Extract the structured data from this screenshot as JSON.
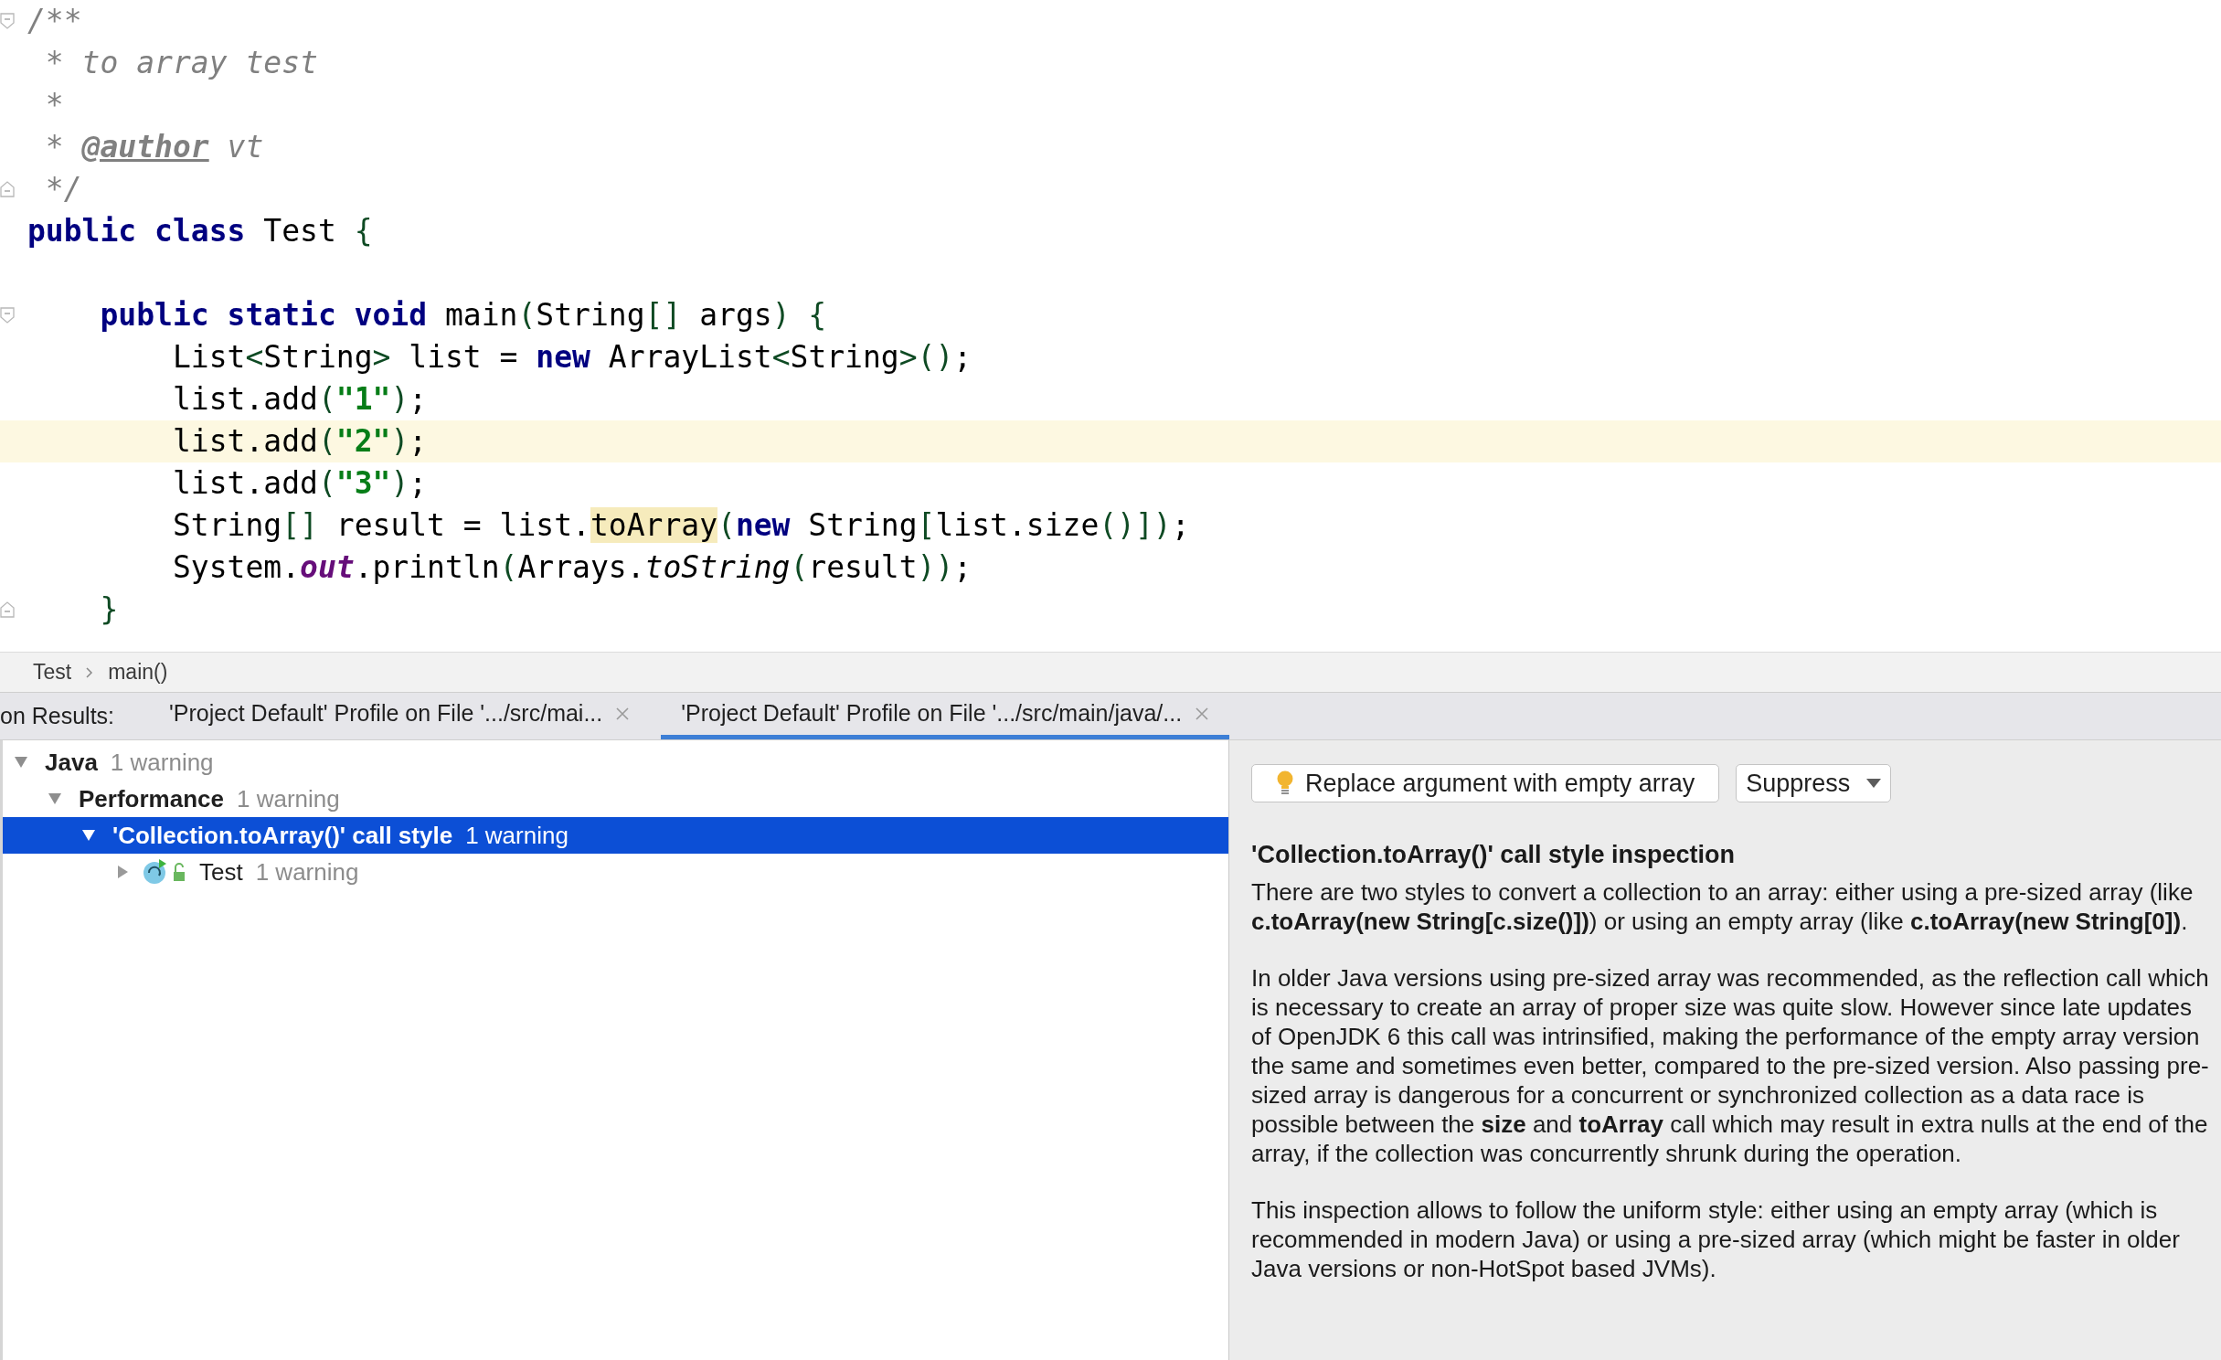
{
  "editor": {
    "lines": [
      {
        "fold_start": true,
        "current": false,
        "tokens": [
          {
            "text": "/**",
            "kind": "comment"
          }
        ]
      },
      {
        "current": false,
        "tokens": [
          {
            "text": " * to array test",
            "kind": "comment"
          }
        ]
      },
      {
        "current": false,
        "tokens": [
          {
            "text": " *",
            "kind": "comment"
          }
        ]
      },
      {
        "current": false,
        "tokens": [
          {
            "text": " * ",
            "kind": "comment"
          },
          {
            "text": "@author",
            "kind": "doc_tag"
          },
          {
            "text": " vt",
            "kind": "comment"
          }
        ]
      },
      {
        "fold_end": true,
        "current": false,
        "tokens": [
          {
            "text": " */",
            "kind": "comment"
          }
        ]
      },
      {
        "current": false,
        "tokens": [
          {
            "text": "public class",
            "kind": "keyword"
          },
          {
            "text": " Test ",
            "kind": "plain"
          },
          {
            "text": "{",
            "kind": "bracket"
          }
        ]
      },
      {
        "blank_before": true,
        "fold_start": true,
        "current": false,
        "tokens": [
          {
            "text": "    public static void",
            "kind": "keyword"
          },
          {
            "text": " main",
            "kind": "plain"
          },
          {
            "text": "(",
            "kind": "bracket"
          },
          {
            "text": "String",
            "kind": "plain"
          },
          {
            "text": "[]",
            "kind": "bracket"
          },
          {
            "text": " args",
            "kind": "plain"
          },
          {
            "text": ") {",
            "kind": "bracket"
          }
        ]
      },
      {
        "current": false,
        "tokens": [
          {
            "text": "        List",
            "kind": "plain"
          },
          {
            "text": "<",
            "kind": "bracket"
          },
          {
            "text": "String",
            "kind": "plain"
          },
          {
            "text": ">",
            "kind": "bracket"
          },
          {
            "text": " list = ",
            "kind": "plain"
          },
          {
            "text": "new",
            "kind": "keyword"
          },
          {
            "text": " ArrayList",
            "kind": "plain"
          },
          {
            "text": "<",
            "kind": "bracket"
          },
          {
            "text": "String",
            "kind": "plain"
          },
          {
            "text": ">()",
            "kind": "bracket"
          },
          {
            "text": ";",
            "kind": "plain"
          }
        ]
      },
      {
        "current": false,
        "tokens": [
          {
            "text": "        list.add",
            "kind": "plain"
          },
          {
            "text": "(",
            "kind": "bracket"
          },
          {
            "text": "\"1\"",
            "kind": "string"
          },
          {
            "text": ")",
            "kind": "bracket"
          },
          {
            "text": ";",
            "kind": "plain"
          }
        ]
      },
      {
        "current": true,
        "tokens": [
          {
            "text": "        list.add",
            "kind": "plain"
          },
          {
            "text": "(",
            "kind": "bracket"
          },
          {
            "text": "\"2\"",
            "kind": "string"
          },
          {
            "text": ")",
            "kind": "bracket"
          },
          {
            "text": ";",
            "kind": "plain"
          }
        ]
      },
      {
        "current": false,
        "tokens": [
          {
            "text": "        list.add",
            "kind": "plain"
          },
          {
            "text": "(",
            "kind": "bracket"
          },
          {
            "text": "\"3\"",
            "kind": "string"
          },
          {
            "text": ")",
            "kind": "bracket"
          },
          {
            "text": ";",
            "kind": "plain"
          }
        ]
      },
      {
        "current": false,
        "tokens": [
          {
            "text": "        String",
            "kind": "plain"
          },
          {
            "text": "[]",
            "kind": "bracket"
          },
          {
            "text": " result = list.",
            "kind": "plain"
          },
          {
            "text": "toArray",
            "kind": "highlight"
          },
          {
            "text": "(",
            "kind": "bracket"
          },
          {
            "text": "new",
            "kind": "keyword"
          },
          {
            "text": " String",
            "kind": "plain"
          },
          {
            "text": "[",
            "kind": "bracket"
          },
          {
            "text": "list.size",
            "kind": "plain"
          },
          {
            "text": "()])",
            "kind": "bracket"
          },
          {
            "text": ";",
            "kind": "plain"
          }
        ]
      },
      {
        "current": false,
        "tokens": [
          {
            "text": "        System.",
            "kind": "plain"
          },
          {
            "text": "out",
            "kind": "field"
          },
          {
            "text": ".println",
            "kind": "plain"
          },
          {
            "text": "(",
            "kind": "bracket"
          },
          {
            "text": "Arrays.",
            "kind": "plain"
          },
          {
            "text": "toString",
            "kind": "static_call"
          },
          {
            "text": "(",
            "kind": "bracket"
          },
          {
            "text": "result",
            "kind": "plain"
          },
          {
            "text": "))",
            "kind": "bracket"
          },
          {
            "text": ";",
            "kind": "plain"
          }
        ]
      },
      {
        "fold_end": true,
        "current": false,
        "tokens": [
          {
            "text": "    }",
            "kind": "bracket"
          }
        ]
      }
    ]
  },
  "breadcrumb": [
    "Test",
    "main()"
  ],
  "results_tabs": {
    "label": "on Results:",
    "tabs": [
      {
        "title": "'Project Default' Profile on File '.../src/mai...",
        "selected": false
      },
      {
        "title": "'Project Default' Profile on File '.../src/main/java/...",
        "selected": true
      }
    ]
  },
  "tree": [
    {
      "label": "Java",
      "count": "1 warning",
      "kind": "group",
      "expanded": true,
      "selected": false,
      "children": [
        {
          "label": "Performance",
          "count": "1 warning",
          "kind": "group",
          "expanded": true,
          "selected": false,
          "children": [
            {
              "label": "'Collection.toArray()' call style",
              "count": "1 warning",
              "kind": "group",
              "expanded": true,
              "selected": true,
              "children": [
                {
                  "label": "Test",
                  "count": "1 warning",
                  "kind": "class",
                  "expanded": false,
                  "selected": false
                }
              ]
            }
          ]
        }
      ]
    }
  ],
  "details": {
    "fix_button": "Replace argument with empty array",
    "suppress_button": "Suppress",
    "title": "'Collection.toArray()' call style inspection",
    "paragraphs": [
      "There are two styles to convert a collection to an array: either using a pre-sized array (like **c.toArray(new String[c.size()])**) or using an empty array (like **c.toArray(new String[0])**.",
      "In older Java versions using pre-sized array was recommended, as the reflection call which is necessary to create an array of proper size was quite slow. However since late updates of OpenJDK 6 this call was intrinsified, making the performance of the empty array version the same and sometimes even better, compared to the pre-sized version. Also passing pre-sized array is dangerous for a concurrent or synchronized collection as a data race is possible between the **size** and **toArray** call which may result in extra nulls at the end of the array, if the collection was concurrently shrunk during the operation.",
      "This inspection allows to follow the uniform style: either using an empty array (which is recommended in modern Java) or using a pre-sized array (which might be faster in older Java versions or non-HotSpot based JVMs)."
    ]
  }
}
